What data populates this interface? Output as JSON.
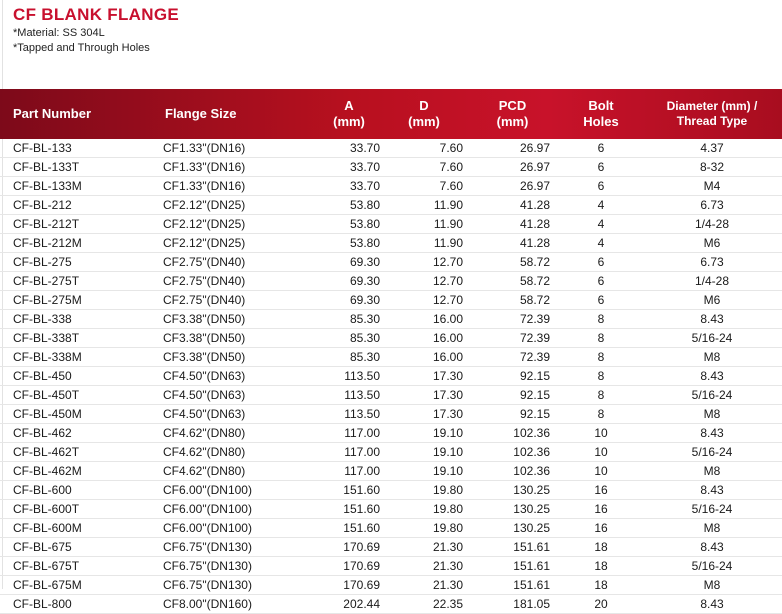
{
  "header": {
    "title": "CF BLANK FLANGE",
    "material": "*Material: SS 304L",
    "holes": "*Tapped and Through Holes"
  },
  "table": {
    "columns": {
      "part_number": "Part Number",
      "flange_size": "Flange Size",
      "a_line1": "A",
      "a_line2": "(mm)",
      "d_line1": "D",
      "d_line2": "(mm)",
      "pcd_line1": "PCD",
      "pcd_line2": "(mm)",
      "bolt_line1": "Bolt",
      "bolt_line2": "Holes",
      "diam_line1": "Diameter (mm) /",
      "diam_line2": "Thread Type"
    },
    "rows": [
      [
        "CF-BL-133",
        "CF1.33\"(DN16)",
        "33.70",
        "7.60",
        "26.97",
        "6",
        "4.37"
      ],
      [
        "CF-BL-133T",
        "CF1.33\"(DN16)",
        "33.70",
        "7.60",
        "26.97",
        "6",
        "8-32"
      ],
      [
        "CF-BL-133M",
        "CF1.33\"(DN16)",
        "33.70",
        "7.60",
        "26.97",
        "6",
        "M4"
      ],
      [
        "CF-BL-212",
        "CF2.12\"(DN25)",
        "53.80",
        "11.90",
        "41.28",
        "4",
        "6.73"
      ],
      [
        "CF-BL-212T",
        "CF2.12\"(DN25)",
        "53.80",
        "11.90",
        "41.28",
        "4",
        "1/4-28"
      ],
      [
        "CF-BL-212M",
        "CF2.12\"(DN25)",
        "53.80",
        "11.90",
        "41.28",
        "4",
        "M6"
      ],
      [
        "CF-BL-275",
        "CF2.75\"(DN40)",
        "69.30",
        "12.70",
        "58.72",
        "6",
        "6.73"
      ],
      [
        "CF-BL-275T",
        "CF2.75\"(DN40)",
        "69.30",
        "12.70",
        "58.72",
        "6",
        "1/4-28"
      ],
      [
        "CF-BL-275M",
        "CF2.75\"(DN40)",
        "69.30",
        "12.70",
        "58.72",
        "6",
        "M6"
      ],
      [
        "CF-BL-338",
        "CF3.38\"(DN50)",
        "85.30",
        "16.00",
        "72.39",
        "8",
        "8.43"
      ],
      [
        "CF-BL-338T",
        "CF3.38\"(DN50)",
        "85.30",
        "16.00",
        "72.39",
        "8",
        "5/16-24"
      ],
      [
        "CF-BL-338M",
        "CF3.38\"(DN50)",
        "85.30",
        "16.00",
        "72.39",
        "8",
        "M8"
      ],
      [
        "CF-BL-450",
        "CF4.50\"(DN63)",
        "113.50",
        "17.30",
        "92.15",
        "8",
        "8.43"
      ],
      [
        "CF-BL-450T",
        "CF4.50\"(DN63)",
        "113.50",
        "17.30",
        "92.15",
        "8",
        "5/16-24"
      ],
      [
        "CF-BL-450M",
        "CF4.50\"(DN63)",
        "113.50",
        "17.30",
        "92.15",
        "8",
        "M8"
      ],
      [
        "CF-BL-462",
        "CF4.62\"(DN80)",
        "117.00",
        "19.10",
        "102.36",
        "10",
        "8.43"
      ],
      [
        "CF-BL-462T",
        "CF4.62\"(DN80)",
        "117.00",
        "19.10",
        "102.36",
        "10",
        "5/16-24"
      ],
      [
        "CF-BL-462M",
        "CF4.62\"(DN80)",
        "117.00",
        "19.10",
        "102.36",
        "10",
        "M8"
      ],
      [
        "CF-BL-600",
        "CF6.00\"(DN100)",
        "151.60",
        "19.80",
        "130.25",
        "16",
        "8.43"
      ],
      [
        "CF-BL-600T",
        "CF6.00\"(DN100)",
        "151.60",
        "19.80",
        "130.25",
        "16",
        "5/16-24"
      ],
      [
        "CF-BL-600M",
        "CF6.00\"(DN100)",
        "151.60",
        "19.80",
        "130.25",
        "16",
        "M8"
      ],
      [
        "CF-BL-675",
        "CF6.75\"(DN130)",
        "170.69",
        "21.30",
        "151.61",
        "18",
        "8.43"
      ],
      [
        "CF-BL-675T",
        "CF6.75\"(DN130)",
        "170.69",
        "21.30",
        "151.61",
        "18",
        "5/16-24"
      ],
      [
        "CF-BL-675M",
        "CF6.75\"(DN130)",
        "170.69",
        "21.30",
        "151.61",
        "18",
        "M8"
      ],
      [
        "CF-BL-800",
        "CF8.00\"(DN160)",
        "202.44",
        "22.35",
        "181.05",
        "20",
        "8.43"
      ]
    ]
  },
  "colors": {
    "title": "#c8102e",
    "header_bg": "#b8101f"
  }
}
